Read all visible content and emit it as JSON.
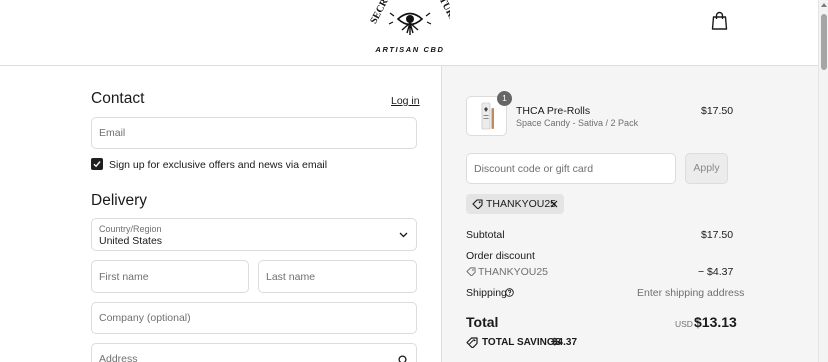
{
  "brand": {
    "name_arc_left": "SECR",
    "name_arc_right": "TURE",
    "tagline": "ARTISAN CBD"
  },
  "contact": {
    "heading": "Contact",
    "login_link": "Log in",
    "email_placeholder": "Email",
    "newsletter_label": "Sign up for exclusive offers and news via email",
    "newsletter_checked": true
  },
  "delivery": {
    "heading": "Delivery",
    "country_label": "Country/Region",
    "country_value": "United States",
    "first_name_placeholder": "First name",
    "last_name_placeholder": "Last name",
    "company_placeholder": "Company (optional)",
    "address_placeholder": "Address"
  },
  "order": {
    "item": {
      "quantity": "1",
      "title": "THCA Pre-Rolls",
      "variant": "Space Candy - Sativa / 2 Pack",
      "price": "$17.50"
    },
    "discount_placeholder": "Discount code or gift card",
    "apply_label": "Apply",
    "applied_code": "THANKYOU25",
    "subtotal_label": "Subtotal",
    "subtotal_value": "$17.50",
    "order_discount_label": "Order discount",
    "discount_code": "THANKYOU25",
    "discount_value": "− $4.37",
    "shipping_label": "Shipping",
    "shipping_value": "Enter shipping address",
    "total_label": "Total",
    "currency": "USD",
    "total_value": "$13.13",
    "savings_label": "TOTAL SAVINGS",
    "savings_value": "$4.37"
  },
  "colors": {
    "accent": "#1f1f1f",
    "panel_bg": "#f5f5f5",
    "border": "#dcdcdc"
  },
  "icons": [
    "bag-icon",
    "checkmark-icon",
    "chevron-down-icon",
    "search-icon",
    "tag-icon",
    "close-icon",
    "help-circle-icon"
  ]
}
